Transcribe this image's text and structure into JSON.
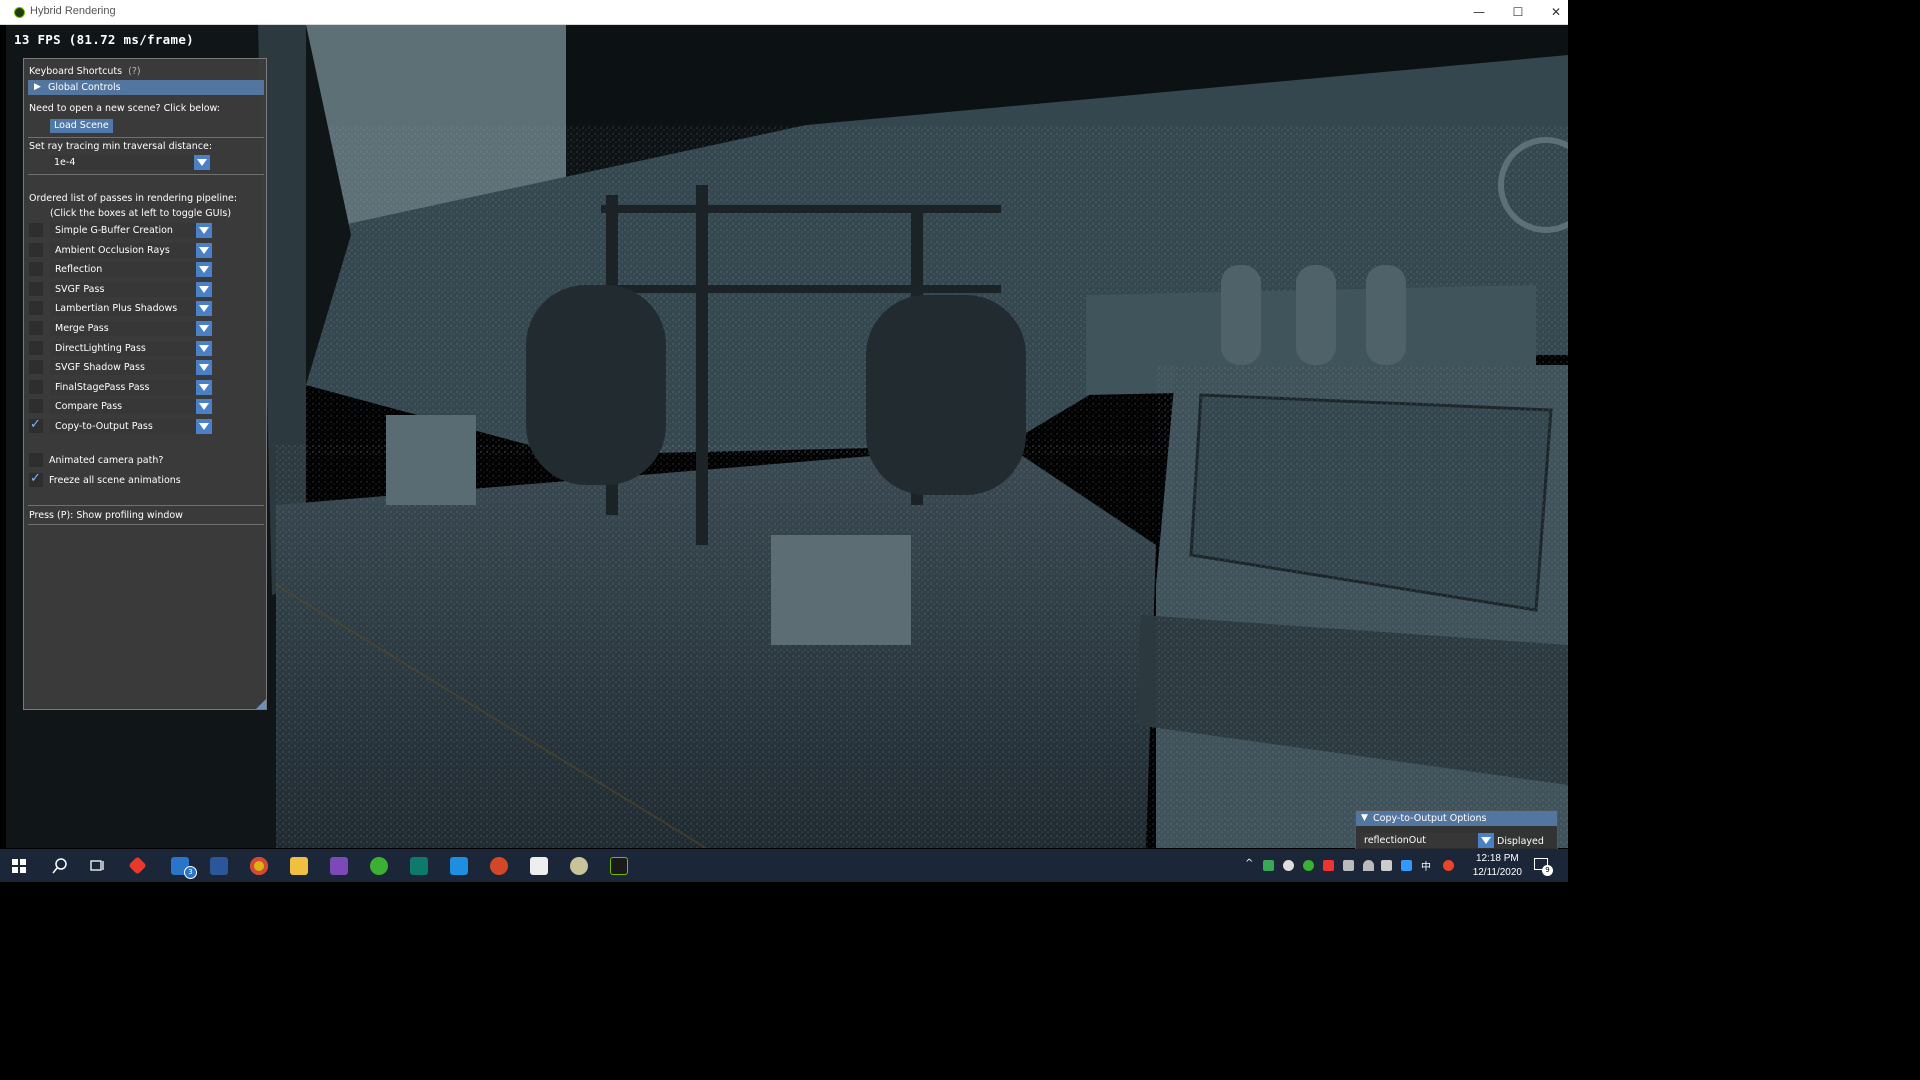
{
  "window": {
    "title": "Hybrid Rendering",
    "minimize": "—",
    "maximize": "☐",
    "close": "✕"
  },
  "fps": "13 FPS (81.72 ms/frame)",
  "panel": {
    "shortcuts_label": "Keyboard Shortcuts",
    "shortcuts_help": "(?)",
    "global_controls": "Global Controls",
    "new_scene_prompt": "Need to open a new scene?  Click below:",
    "load_scene": "Load Scene",
    "min_distance_label": "Set ray tracing min traversal distance:",
    "min_distance_value": "1e-4",
    "passes_title": "Ordered list of passes in rendering pipeline:",
    "passes_subtitle": "(Click the boxes at left to toggle GUIs)",
    "passes": [
      {
        "label": "Simple G-Buffer Creation",
        "checked": false
      },
      {
        "label": "Ambient Occlusion Rays",
        "checked": false
      },
      {
        "label": "Reflection",
        "checked": false
      },
      {
        "label": "SVGF Pass",
        "checked": false
      },
      {
        "label": "Lambertian Plus Shadows",
        "checked": false
      },
      {
        "label": "Merge Pass",
        "checked": false
      },
      {
        "label": "DirectLighting Pass",
        "checked": false
      },
      {
        "label": "SVGF Shadow Pass",
        "checked": false
      },
      {
        "label": "FinalStagePass Pass",
        "checked": false
      },
      {
        "label": "Compare Pass",
        "checked": false
      },
      {
        "label": "Copy-to-Output Pass",
        "checked": true
      }
    ],
    "animated_camera": "Animated camera path?",
    "freeze_animations": "Freeze all scene animations",
    "profiling_hint": "Press (P):  Show profiling window"
  },
  "copy_output_options": {
    "title": "Copy-to-Output Options",
    "selected": "reflectionOut",
    "displayed_label": "Displayed"
  },
  "taskbar": {
    "mail_badge": "3",
    "clock_time": "12:18 PM",
    "clock_date": "12/11/2020",
    "notification_count": "9",
    "ime": "中"
  },
  "colors": {
    "panel_bg": "#3c3c3c",
    "header_blue": "#5276a0",
    "button_blue": "#4f79a8",
    "combo_arrow": "#4a81c6",
    "scene_tint": "#3d525c",
    "taskbar_bg": "#1b2638"
  }
}
